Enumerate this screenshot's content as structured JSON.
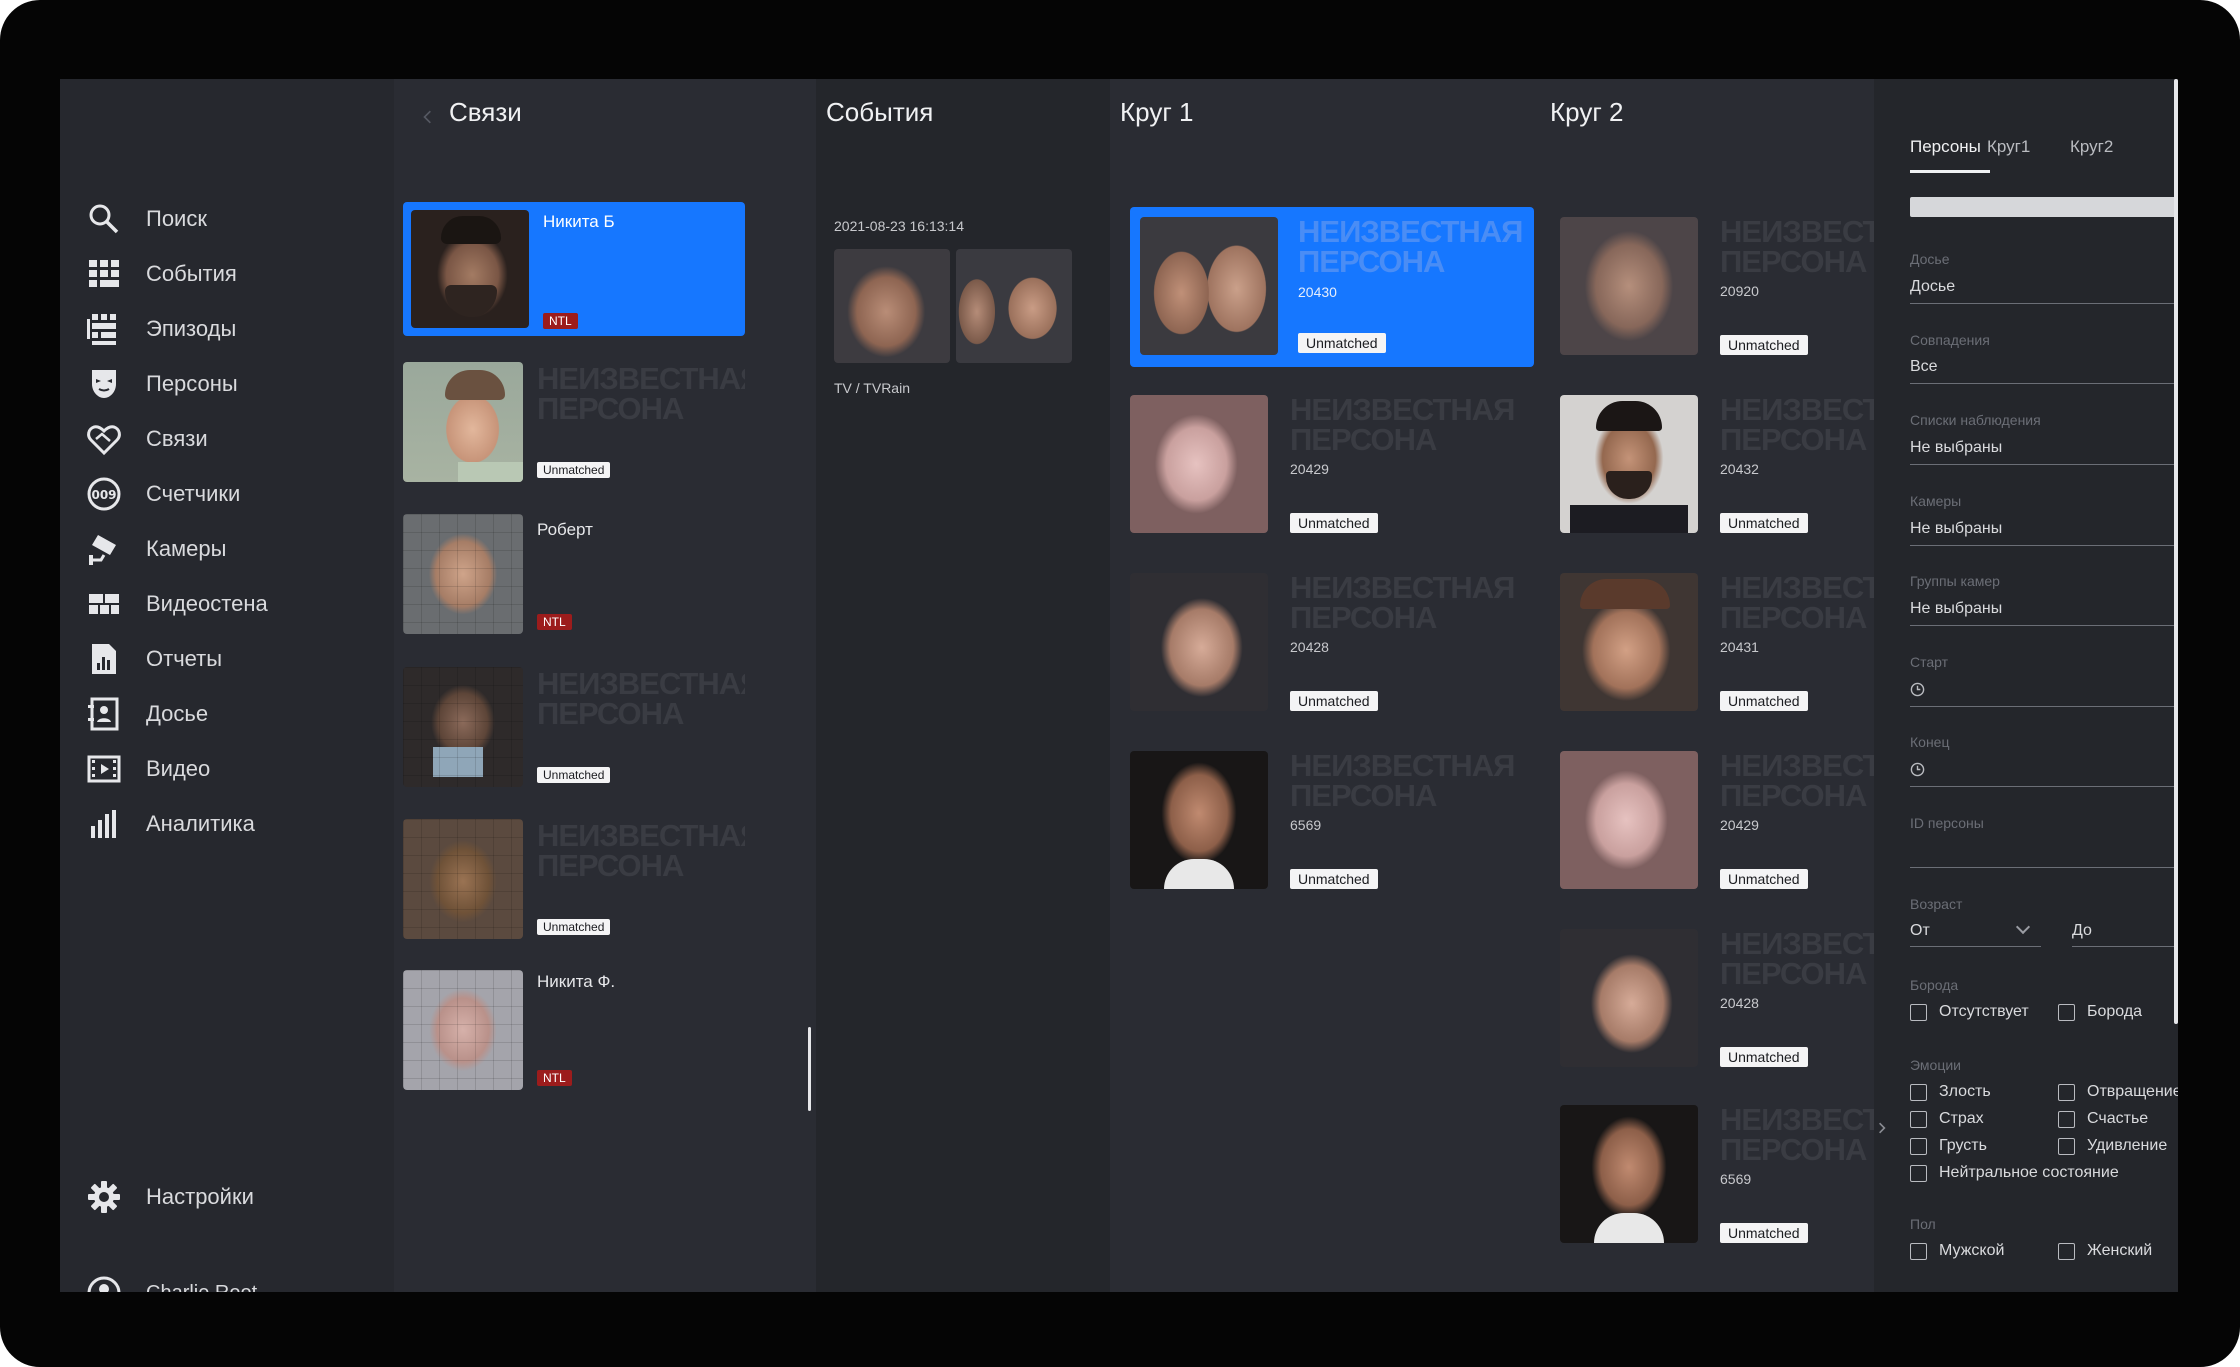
{
  "sidebar": {
    "items": [
      {
        "label": "Поиск",
        "icon": "search-icon"
      },
      {
        "label": "События",
        "icon": "events-grid-icon"
      },
      {
        "label": "Эпизоды",
        "icon": "episodes-icon"
      },
      {
        "label": "Персоны",
        "icon": "person-mask-icon"
      },
      {
        "label": "Связи",
        "icon": "handshake-icon"
      },
      {
        "label": "Счетчики",
        "icon": "counter-icon"
      },
      {
        "label": "Камеры",
        "icon": "camera-icon"
      },
      {
        "label": "Видеостена",
        "icon": "videowall-icon"
      },
      {
        "label": "Отчеты",
        "icon": "report-icon"
      },
      {
        "label": "Досье",
        "icon": "dossier-icon"
      },
      {
        "label": "Видео",
        "icon": "film-icon"
      },
      {
        "label": "Аналитика",
        "icon": "bar-chart-icon"
      }
    ],
    "settings_label": "Настройки",
    "user_name": "Charlie Root"
  },
  "links": {
    "title": "Связи",
    "persons": [
      {
        "name": "Никита Б",
        "badge": "NTL",
        "unknown": "",
        "status": ""
      },
      {
        "name": "",
        "badge": "",
        "unknown": "НЕИЗВЕСТНАЯ\nПЕРСОНА",
        "status": "Unmatched"
      },
      {
        "name": "Роберт",
        "badge": "NTL",
        "unknown": "",
        "status": ""
      },
      {
        "name": "",
        "badge": "",
        "unknown": "НЕИЗВЕСТНАЯ\nПЕРСОНА",
        "status": "Unmatched"
      },
      {
        "name": "",
        "badge": "",
        "unknown": "НЕИЗВЕСТНАЯ\nПЕРСОНА",
        "status": "Unmatched"
      },
      {
        "name": "Никита Ф.",
        "badge": "NTL",
        "unknown": "",
        "status": ""
      }
    ]
  },
  "events": {
    "title": "События",
    "timestamp": "2021-08-23 16:13:14",
    "source": "TV / TVRain"
  },
  "circle1": {
    "title": "Круг 1",
    "cards": [
      {
        "unknown": "НЕИЗВЕСТНАЯ\nПЕРСОНА",
        "id": "20430",
        "status": "Unmatched"
      },
      {
        "unknown": "НЕИЗВЕСТНАЯ\nПЕРСОНА",
        "id": "20429",
        "status": "Unmatched"
      },
      {
        "unknown": "НЕИЗВЕСТНАЯ\nПЕРСОНА",
        "id": "20428",
        "status": "Unmatched"
      },
      {
        "unknown": "НЕИЗВЕСТНАЯ\nПЕРСОНА",
        "id": "6569",
        "status": "Unmatched"
      }
    ]
  },
  "circle2": {
    "title": "Круг 2",
    "cards": [
      {
        "unknown": "НЕИЗВЕСТ\nПЕРСОНА",
        "id": "20920",
        "status": "Unmatched"
      },
      {
        "unknown": "НЕИЗВЕСТ\nПЕРСОНА",
        "id": "20432",
        "status": "Unmatched"
      },
      {
        "unknown": "НЕИЗВЕСТ\nПЕРСОНА",
        "id": "20431",
        "status": "Unmatched"
      },
      {
        "unknown": "НЕИЗВЕСТ\nПЕРСОНА",
        "id": "20429",
        "status": "Unmatched"
      },
      {
        "unknown": "НЕИЗВЕСТ\nПЕРСОНА",
        "id": "20428",
        "status": "Unmatched"
      },
      {
        "unknown": "НЕИЗВЕСТ\nПЕРСОНА",
        "id": "6569",
        "status": "Unmatched"
      }
    ]
  },
  "filters": {
    "tabs": [
      "Персоны",
      "Круг1",
      "Круг2"
    ],
    "dossier_label": "Досье",
    "dossier_value": "Досье",
    "match_label": "Совпадения",
    "match_value": "Все",
    "watchlists_label": "Списки наблюдения",
    "watchlists_value": "Не выбраны",
    "cameras_label": "Камеры",
    "cameras_value": "Не выбраны",
    "camera_groups_label": "Группы камер",
    "camera_groups_value": "Не выбраны",
    "start_label": "Старт",
    "end_label": "Конец",
    "person_id_label": "ID персоны",
    "age_label": "Возраст",
    "age_from": "От",
    "age_to": "До",
    "beard_label": "Борода",
    "beard_options": [
      "Отсутствует",
      "Борода"
    ],
    "emotions_label": "Эмоции",
    "emotions": [
      "Злость",
      "Отвращение",
      "Страх",
      "Счастье",
      "Грусть",
      "Удивление",
      "Нейтральное состояние"
    ],
    "gender_label": "Пол",
    "gender_options": [
      "Мужской",
      "Женский"
    ]
  },
  "colors": {
    "accent": "#1677ff",
    "ntl_badge": "#9c1c1c",
    "background": "#26282e"
  }
}
